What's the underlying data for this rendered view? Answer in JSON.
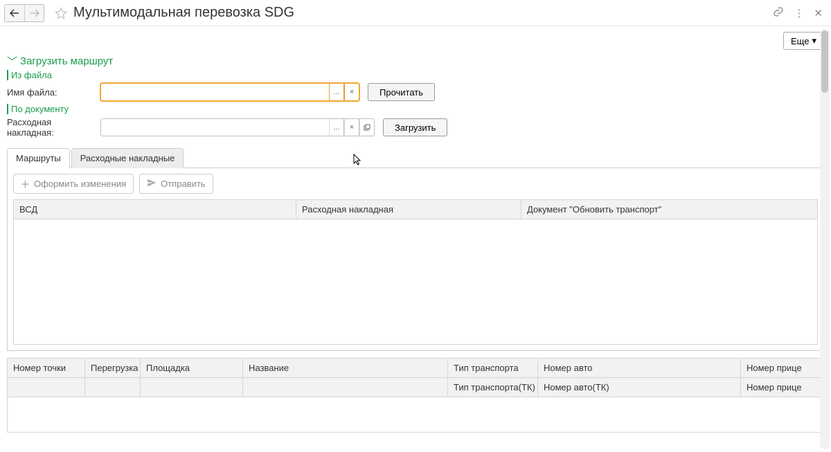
{
  "header": {
    "title": "Мультимодальная перевозка SDG"
  },
  "more_button": "Еще",
  "section": {
    "title": "Загрузить маршрут",
    "from_file": "Из файла",
    "file_label": "Имя файла:",
    "file_value": "",
    "read_btn": "Прочитать",
    "by_doc": "По документу",
    "invoice_label": "Расходная накладная:",
    "invoice_value": "",
    "load_btn": "Загрузить"
  },
  "tabs": {
    "routes": "Маршруты",
    "invoices": "Расходные накладные"
  },
  "toolbar": {
    "commit": "Оформить изменения",
    "send": "Отправить"
  },
  "table1": {
    "col1": "ВСД",
    "col2": "Расходная накладная",
    "col3": "Документ \"Обновить транспорт\""
  },
  "table2": {
    "r1c1": "Номер точки",
    "r1c2": "Перегрузка",
    "r1c3": "Площадка",
    "r1c4": "Название",
    "r1c5": "Тип транспорта",
    "r1c6": "Номер авто",
    "r1c7": "Номер прице",
    "r2c5": "Тип транспорта(ТК)",
    "r2c6": "Номер авто(ТК)",
    "r2c7": "Номер прице"
  }
}
